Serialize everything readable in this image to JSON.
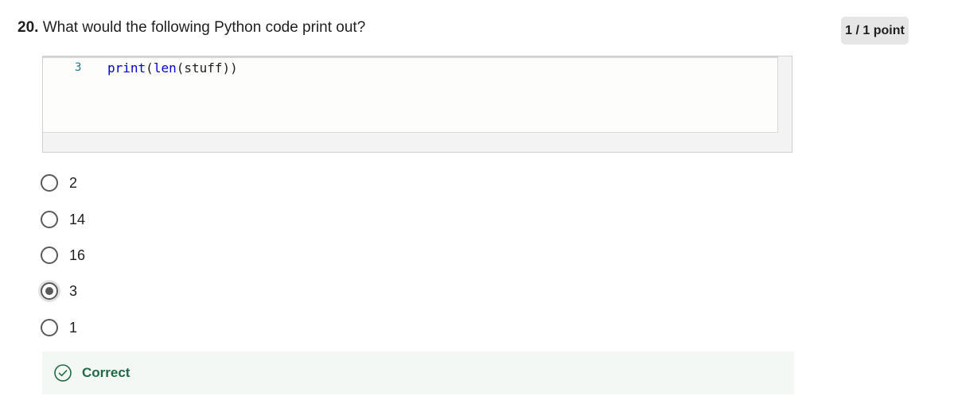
{
  "question": {
    "number": "20.",
    "text": "What would the following Python code print out?"
  },
  "points": {
    "label": "1 / 1 point"
  },
  "code": {
    "line_number": "3",
    "builtin_print": "print",
    "open_paren_1": "(",
    "builtin_len": "len",
    "arg": "(stuff))"
  },
  "options": [
    {
      "label": "2",
      "selected": false
    },
    {
      "label": "14",
      "selected": false
    },
    {
      "label": "16",
      "selected": false
    },
    {
      "label": "3",
      "selected": true
    },
    {
      "label": "1",
      "selected": false
    }
  ],
  "feedback": {
    "label": "Correct",
    "color": "#1f6b47"
  }
}
